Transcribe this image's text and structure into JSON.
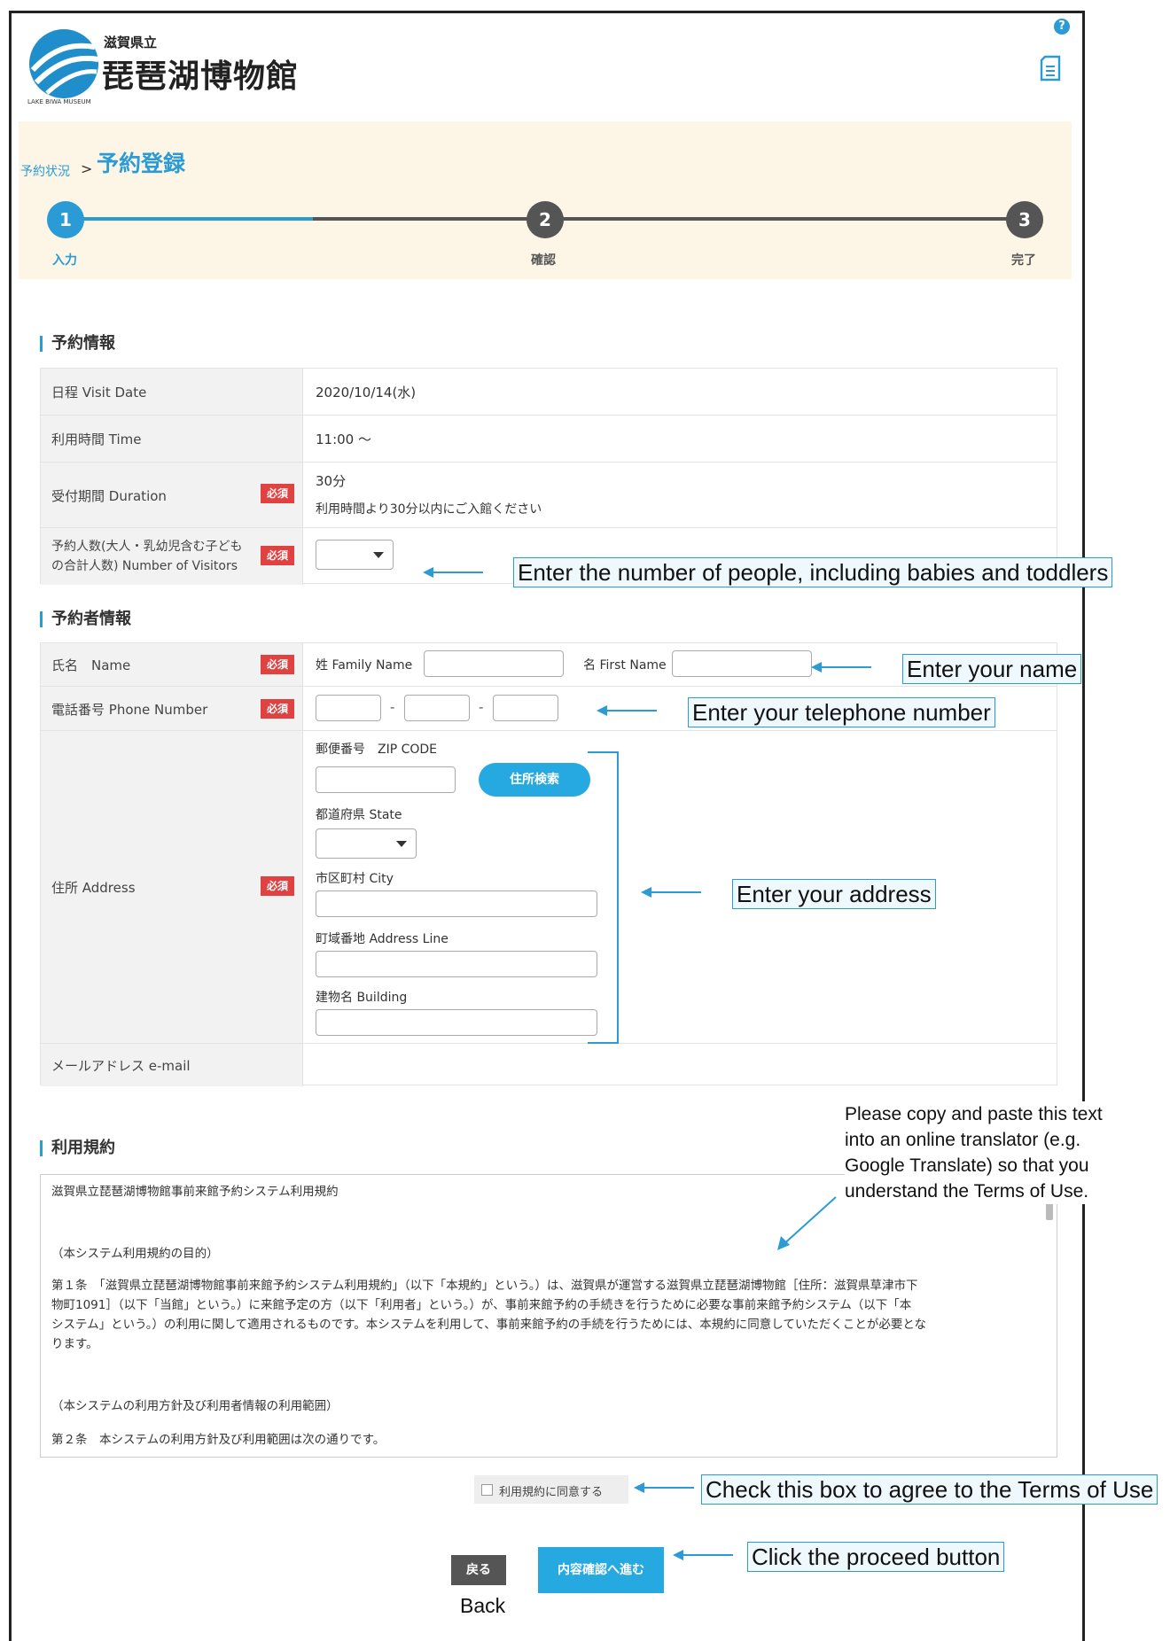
{
  "header": {
    "logo_small": "滋賀県立",
    "logo_big": "琵琶湖博物館",
    "logo_en": "LAKE BIWA MUSEUM",
    "help_glyph": "?"
  },
  "breadcrumb": {
    "parent": "予約状況",
    "separator": ">",
    "current": "予約登録"
  },
  "steps": [
    {
      "number": "1",
      "label": "入力",
      "state": "active",
      "color": "#2a9bd4"
    },
    {
      "number": "2",
      "label": "確認",
      "state": "pending",
      "color": "#555555"
    },
    {
      "number": "3",
      "label": "完了",
      "state": "pending",
      "color": "#555555"
    }
  ],
  "reservation": {
    "title": "予約情報",
    "visit_date_label": "日程 Visit Date",
    "visit_date_value": "2020/10/14(水)",
    "time_label": "利用時間 Time",
    "time_value": "11:00 〜",
    "duration_label": "受付期間 Duration",
    "duration_value": "30分",
    "duration_note": "利用時間より30分以内にご入館ください",
    "visitors_label_1": "予約人数(大人・乳幼児含む子ども",
    "visitors_label_2": "の合計人数) Number of Visitors",
    "visitors_value": ""
  },
  "required_badge": "必須",
  "booker": {
    "title": "予約者情報",
    "name_label": "氏名　Name",
    "family_name_label": "姓 Family Name",
    "first_name_label": "名 First Name",
    "phone_label": "電話番号 Phone Number",
    "phone_dash": "-",
    "address_label": "住所 Address",
    "zip_label": "郵便番号　ZIP CODE",
    "zip_search_button": "住所検索",
    "state_label": "都道府県 State",
    "city_label": "市区町村 City",
    "address_line_label": "町域番地 Address Line",
    "building_label": "建物名 Building",
    "email_label": "メールアドレス e-mail"
  },
  "terms": {
    "title": "利用規約",
    "heading": "滋賀県立琵琶湖博物館事前来館予約システム利用規約",
    "purpose_heading": "（本システム利用規約の目的）",
    "article1_line1": "第１条　「滋賀県立琵琶湖博物館事前来館予約システム利用規約」（以下「本規約」という。）は、滋賀県が運営する滋賀県立琵琶湖博物館［住所：滋賀県草津市下",
    "article1_line2": "物町1091］（以下「当館」という。）に来館予定の方（以下「利用者」という。）が、事前来館予約の手続きを行うために必要な事前来館予約システム（以下「本",
    "article1_line3": "システム」という。）の利用に関して適用されるものです。本システムを利用して、事前来館予約の手続を行うためには、本規約に同意していただくことが必要とな",
    "article1_line4": "ります。",
    "policy_heading": "（本システムの利用方針及び利用者情報の利用範囲）",
    "article2": "第２条　本システムの利用方針及び利用範囲は次の通りです。",
    "agree_label": "利用規約に同意する"
  },
  "buttons": {
    "back": "戻る",
    "proceed": "内容確認へ進む",
    "back_caption": "Back"
  },
  "annotations": {
    "visitors": "Enter the number of people, including babies and toddlers",
    "name": "Enter your name",
    "phone": "Enter your telephone number",
    "address": "Enter your address",
    "terms_note": "Please copy and paste this text into an online translator (e.g. Google Translate) so that you understand the Terms of Use.",
    "agree": "Check this box to agree to the Terms of Use",
    "proceed": "Click the proceed button"
  },
  "colors": {
    "accent": "#2a9bd4",
    "required": "#e04141",
    "band": "#fdf6e6"
  }
}
